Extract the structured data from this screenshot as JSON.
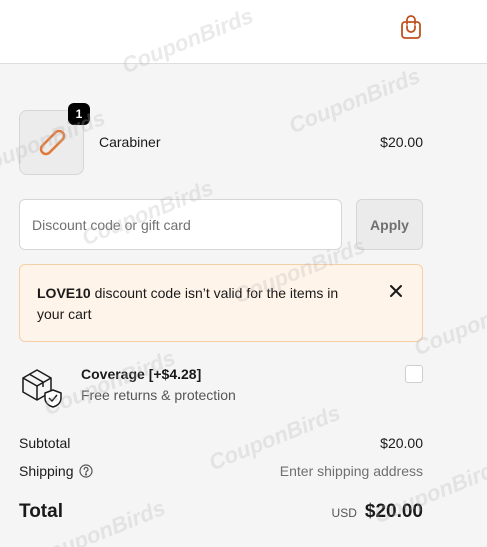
{
  "header": {
    "cart_icon": "shopping-bag-icon",
    "accent_color": "#c0521f"
  },
  "line_item": {
    "quantity": "1",
    "name": "Carabiner",
    "price": "$20.00",
    "thumbnail_icon": "carabiner-icon"
  },
  "discount": {
    "placeholder": "Discount code or gift card",
    "value": "",
    "apply_label": "Apply"
  },
  "error": {
    "code": "LOVE10",
    "message": " discount code isn’t valid for the items in your cart",
    "close_icon": "close-icon",
    "background": "#fff4ea"
  },
  "coverage": {
    "title": "Coverage [+$4.28]",
    "subtitle": "Free returns & protection",
    "icon": "package-shield-icon",
    "checked": false
  },
  "summary": {
    "subtotal_label": "Subtotal",
    "subtotal_value": "$20.00",
    "shipping_label": "Shipping",
    "shipping_value": "Enter shipping address",
    "total_label": "Total",
    "currency": "USD",
    "total_value": "$20.00"
  },
  "watermark": "CouponBirds"
}
